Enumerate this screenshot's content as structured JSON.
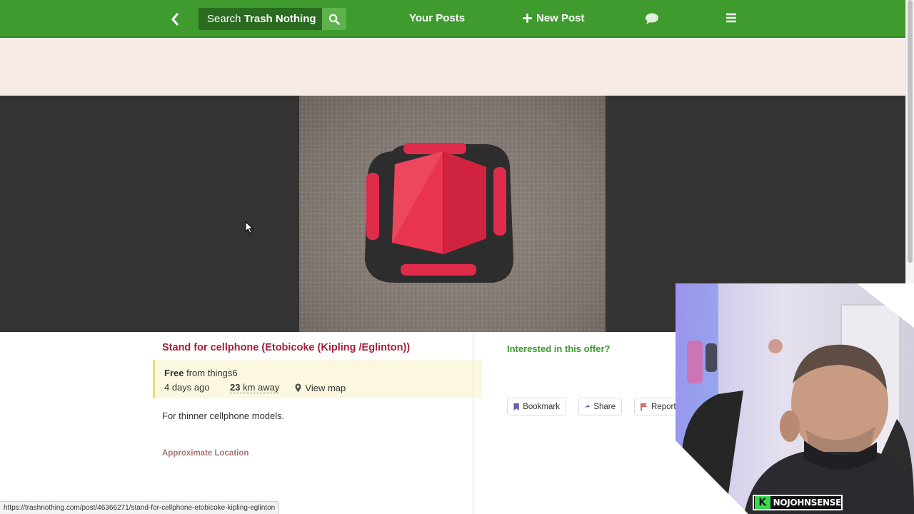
{
  "nav": {
    "search_prefix": "Search",
    "search_brand": "Trash Nothing",
    "your_posts": "Your Posts",
    "new_post": "New Post",
    "brand_color": "#3f9b2e",
    "icons": [
      "chevron-left-icon",
      "search-icon",
      "plus-icon",
      "chat-bubble-icon",
      "hamburger-menu-icon"
    ]
  },
  "post": {
    "title": "Stand for cellphone (Etobicoke (Kipling /Eglinton))",
    "type": "Free",
    "from_text": "from things6",
    "age": "4 days ago",
    "distance_value": "23",
    "distance_unit": "km away",
    "view_map": "View map",
    "description": "For thinner cellphone models.",
    "approx_location": "Approximate Location"
  },
  "sidebar": {
    "interested": "Interested in this offer?",
    "bookmark": "Bookmark",
    "share": "Share",
    "report": "Report"
  },
  "status_bar": {
    "url": "https://trashnothing.com/post/46366271/stand-for-cellphone-etobicoke-kipling-eglinton"
  },
  "overlay": {
    "logo_letter": "K",
    "channel": "NOJOHNSENSE"
  }
}
